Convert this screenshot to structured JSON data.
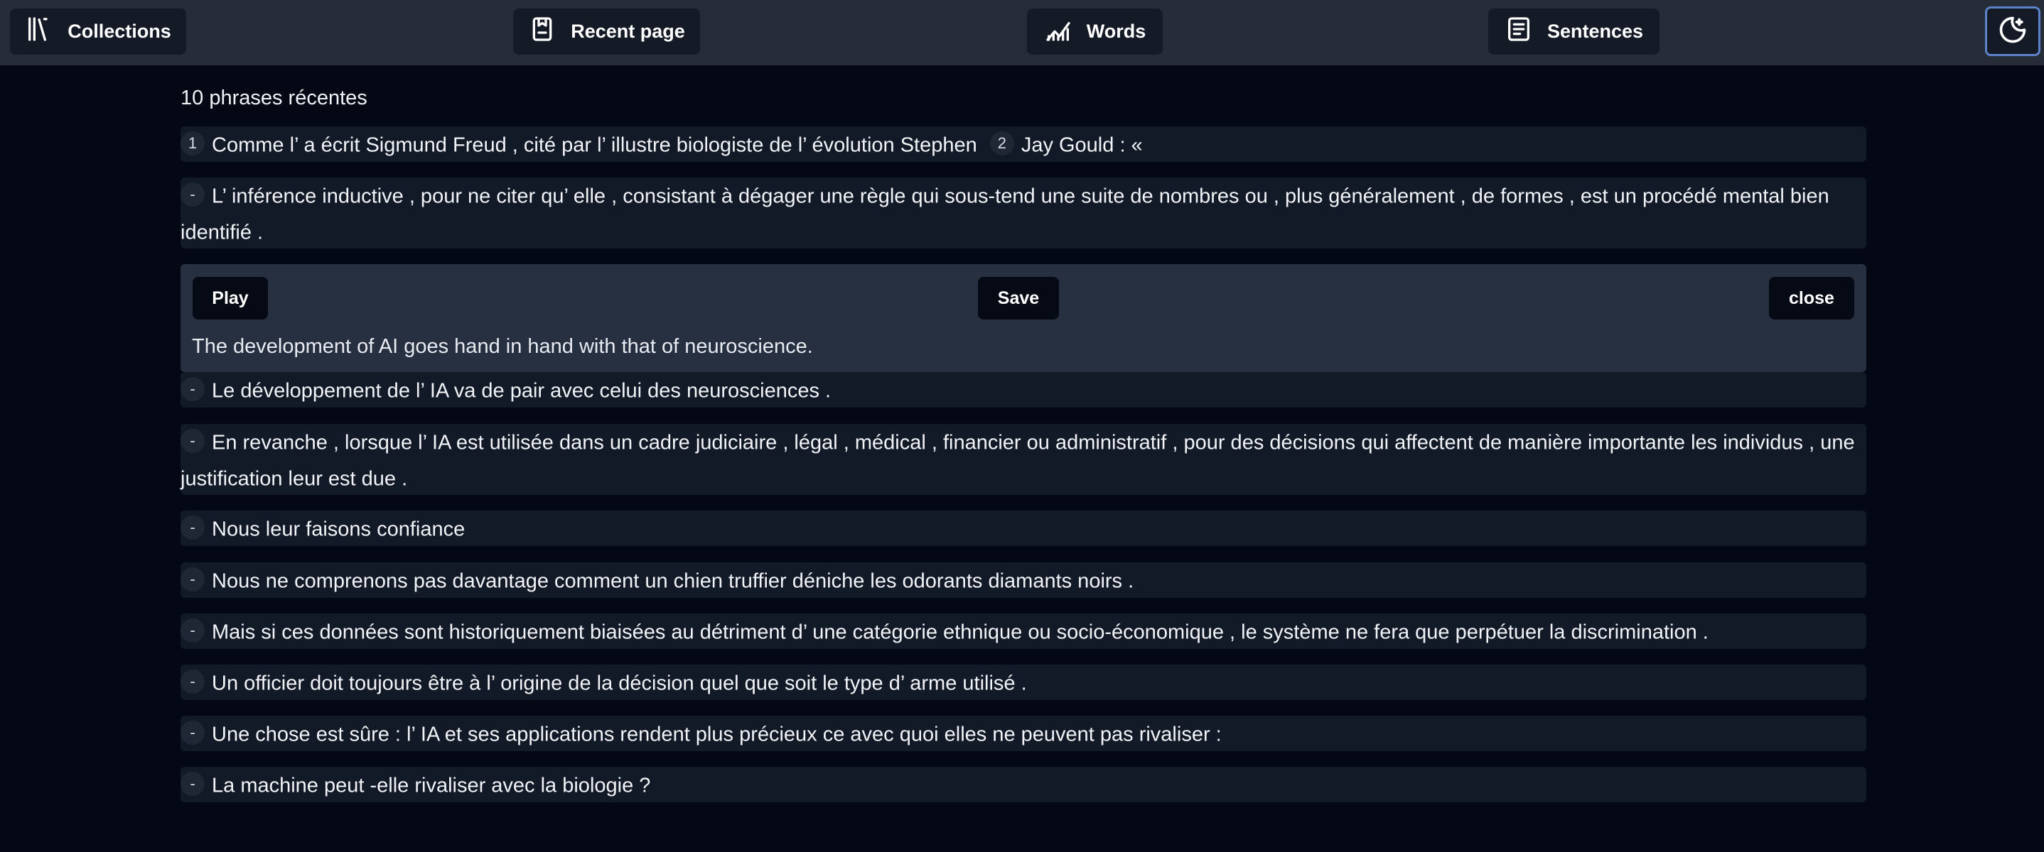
{
  "nav": {
    "collections": "Collections",
    "recent_page": "Recent page",
    "words": "Words",
    "sentences": "Sentences"
  },
  "heading": "10 phrases récentes",
  "sentences": [
    {
      "badge": "1",
      "badge2": "2",
      "part1": "Comme l’ a écrit Sigmund Freud , cité par l’ illustre biologiste de l’ évolution Stephen",
      "part2": "Jay Gould : «"
    },
    {
      "badge": "-",
      "text": "L’ inférence inductive , pour ne citer qu’ elle , consistant à dégager une règle qui sous-tend une suite de nombres ou , plus généralement , de formes , est un procédé mental bien identifié ."
    },
    {
      "badge": "-",
      "text": "Le développement de l’ IA va de pair avec celui des neurosciences ."
    },
    {
      "badge": "-",
      "text": "En revanche , lorsque l’ IA est utilisée dans un cadre judiciaire , légal , médical , financier ou administratif , pour des décisions qui affectent de manière importante les individus , une justification leur est due ."
    },
    {
      "badge": "-",
      "text": "Nous leur faisons confiance"
    },
    {
      "badge": "-",
      "text": "Nous ne comprenons pas davantage comment un chien truffier déniche les odorants diamants noirs ."
    },
    {
      "badge": "-",
      "text": "Mais si ces données sont historiquement biaisées au détriment d’ une catégorie ethnique ou socio-économique , le système ne fera que perpétuer la discrimination ."
    },
    {
      "badge": "-",
      "text": "Un officier doit toujours être à l’ origine de la décision quel que soit le type d’ arme utilisé ."
    },
    {
      "badge": "-",
      "text": "Une chose est sûre : l’ IA et ses applications rendent plus précieux ce avec quoi elles ne peuvent pas rivaliser :"
    },
    {
      "badge": "-",
      "text": "La machine peut -elle rivaliser avec la biologie ?"
    }
  ],
  "panel": {
    "play": "Play",
    "save": "Save",
    "close": "close",
    "translation": "The development of AI goes hand in hand with that of neuroscience."
  },
  "colors": {
    "background": "#040814",
    "topbar": "#272d38",
    "row": "#131a27",
    "panel": "#273041",
    "focus_border": "#5b82c9"
  },
  "icons": [
    "books-icon",
    "bookmark-page-icon",
    "chart-line-icon",
    "list-text-icon",
    "moon-stars-icon"
  ]
}
